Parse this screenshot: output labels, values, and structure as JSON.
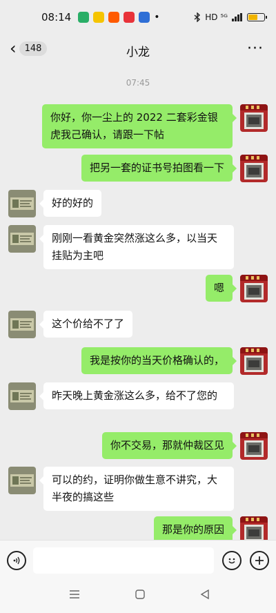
{
  "status_bar": {
    "time": "08:14",
    "dot": "•",
    "signal_text": "HD ⁵ᴳ",
    "battery_level": 0.55
  },
  "header": {
    "back_icon": "‹",
    "unread_count": "148",
    "title": "小龙",
    "more_icon": "···"
  },
  "chat": {
    "timestamp": "07:45",
    "messages": [
      {
        "side": "right",
        "text": "你好，你一尘上的 2022 二套彩金银虎我己确认，请跟一下帖"
      },
      {
        "side": "right",
        "text": "把另一套的证书号拍图看一下"
      },
      {
        "side": "left",
        "text": "好的好的"
      },
      {
        "side": "left",
        "text": "刚刚一看黄金突然涨这么多，以当天挂贴为主吧"
      },
      {
        "side": "right",
        "text": "嗯"
      },
      {
        "side": "left",
        "text": "这个价给不了了"
      },
      {
        "side": "right",
        "text": "我是按你的当天价格确认的，"
      },
      {
        "side": "left",
        "text": "昨天晚上黄金涨这么多，给不了您的"
      },
      {
        "side": "right",
        "text": "你不交易，那就仲裁区见"
      },
      {
        "side": "left",
        "text": "可以的约，证明你做生意不讲究，大半夜的搞这些"
      },
      {
        "side": "right",
        "text": "那是你的原因"
      }
    ]
  },
  "input_bar": {
    "voice_icon": "voice-icon",
    "emoji_icon": "emoji-icon",
    "plus_icon": "plus-icon"
  },
  "colors": {
    "background": "#ededed",
    "outgoing_bubble": "#95ec69",
    "incoming_bubble": "#ffffff"
  }
}
